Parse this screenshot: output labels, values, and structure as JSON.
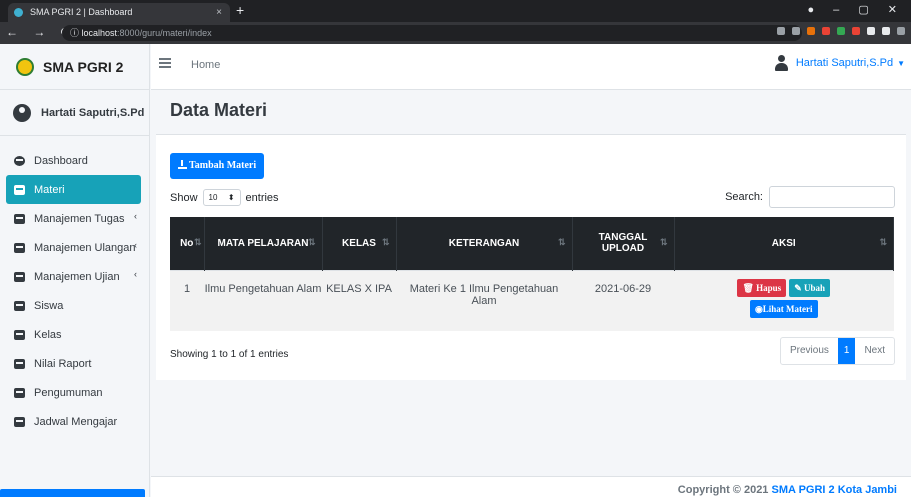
{
  "browser": {
    "tab_title": "SMA PGRI 2 | Dashboard",
    "tab_close": "×",
    "new_tab": "+",
    "url_host": "localhost",
    "url_path": ":8000/guru/materi/index"
  },
  "sidebar": {
    "brand": "SMA PGRI 2",
    "user_name": "Hartati Saputri,S.Pd",
    "items": [
      {
        "label": "Dashboard",
        "icon": "dashboard-icon"
      },
      {
        "label": "Materi",
        "icon": "book-icon",
        "active": true
      },
      {
        "label": "Manajemen Tugas",
        "icon": "book-icon",
        "arrow": "‹"
      },
      {
        "label": "Manajemen Ulangan",
        "icon": "book-icon",
        "arrow": "‹"
      },
      {
        "label": "Manajemen Ujian",
        "icon": "book-icon",
        "arrow": "‹"
      },
      {
        "label": "Siswa",
        "icon": "book-icon"
      },
      {
        "label": "Kelas",
        "icon": "book-icon"
      },
      {
        "label": "Nilai Raport",
        "icon": "book-icon"
      },
      {
        "label": "Pengumuman",
        "icon": "book-icon"
      },
      {
        "label": "Jadwal Mengajar",
        "icon": "book-icon"
      }
    ]
  },
  "topnav": {
    "home": "Home",
    "user": "Hartati Saputri,S.Pd",
    "caret": "▼"
  },
  "page": {
    "title": "Data Materi",
    "add_button": "Tambah Materi",
    "show_label": "Show",
    "show_value": "10",
    "entries_label": "entries",
    "search_label": "Search:",
    "showing": "Showing 1 to 1 of 1 entries",
    "prev": "Previous",
    "page_num": "1",
    "next": "Next"
  },
  "table": {
    "headers": [
      "No",
      "MATA PELAJARAN",
      "KELAS",
      "KETERANGAN",
      "TANGGAL UPLOAD",
      "AKSI"
    ],
    "rows": [
      {
        "no": "1",
        "mapel": "Ilmu Pengetahuan Alam",
        "kelas": "KELAS X IPA",
        "keterangan": "Materi Ke 1 Ilmu Pengetahuan Alam",
        "tanggal": "2021-06-29"
      }
    ],
    "actions": {
      "hapus": "Hapus",
      "ubah": "Ubah",
      "lihat": "Lihat Materi"
    }
  },
  "footer": {
    "prefix": "Copyright © 2021 ",
    "link": "SMA PGRI 2 Kota Jambi"
  }
}
